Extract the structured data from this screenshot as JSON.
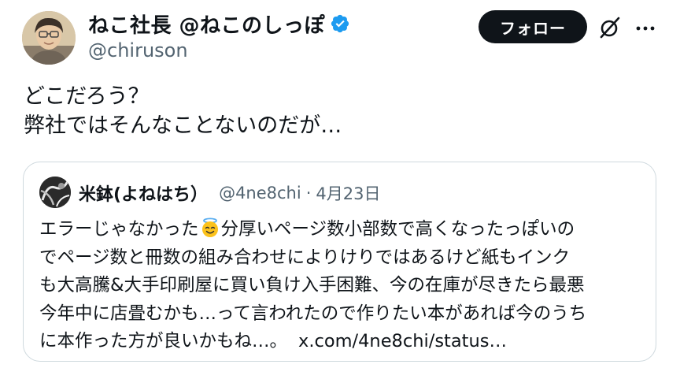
{
  "author": {
    "display_name": "ねこ社長 @ねこのしっぽ",
    "handle": "@chiruson",
    "verified_icon": "verified-badge-icon",
    "avatar_icon": "avatar"
  },
  "actions": {
    "follow_label": "フォロー",
    "grok_icon": "grok-icon",
    "more_icon": "more-icon"
  },
  "post": {
    "lines": [
      "どこだろう？",
      "弊社ではそんなことないのだが…"
    ]
  },
  "quote": {
    "display_name": "米鉢(よねはち）",
    "handle": "@4ne8chi",
    "separator": "·",
    "date": "4月23日",
    "line1_before_emoji": "エラーじゃなかった",
    "emoji_name": "smiling-face-with-halo",
    "line1_after_emoji": "分厚いページ数小部数で高くなったっぽいの",
    "lines": [
      "でページ数と冊数の組み合わせによりけりではあるけど紙もインク",
      "も大高騰&大手印刷屋に買い負け入手困難、今の在庫が尽きたら最悪",
      "今年中に店畳むかも…って言われたので作りたい本があれば今のうち"
    ],
    "last_line": "に本作った方が良いかもね…。",
    "link": "x.com/4ne8chi/status…"
  },
  "colors": {
    "text": "#0f1419",
    "secondary": "#536471",
    "border": "#cfd9de",
    "verified": "#1d9bf0",
    "button_bg": "#0f1419"
  }
}
